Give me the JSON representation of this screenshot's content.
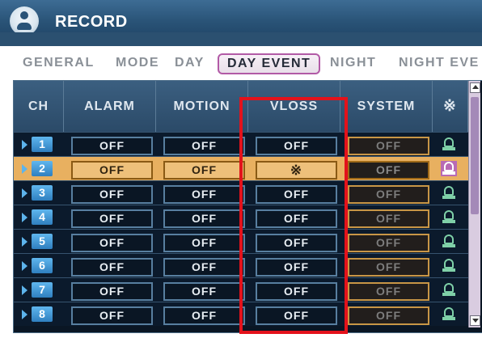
{
  "window": {
    "title": "RECORD",
    "logo_icon": "record-logo-icon"
  },
  "tabs": [
    {
      "label": "GENERAL",
      "active": false
    },
    {
      "label": "MODE",
      "active": false
    },
    {
      "label": "DAY",
      "active": false
    },
    {
      "label": "DAY EVENT",
      "active": true
    },
    {
      "label": "NIGHT",
      "active": false
    },
    {
      "label": "NIGHT EVE",
      "active": false
    }
  ],
  "table": {
    "columns": [
      "CH",
      "ALARM",
      "MOTION",
      "VLOSS",
      "SYSTEM",
      "※"
    ],
    "rows": [
      {
        "ch": "1",
        "alarm": "OFF",
        "motion": "OFF",
        "vloss": "OFF",
        "system": "OFF",
        "selected": false
      },
      {
        "ch": "2",
        "alarm": "OFF",
        "motion": "OFF",
        "vloss": "※",
        "system": "OFF",
        "selected": true
      },
      {
        "ch": "3",
        "alarm": "OFF",
        "motion": "OFF",
        "vloss": "OFF",
        "system": "OFF",
        "selected": false
      },
      {
        "ch": "4",
        "alarm": "OFF",
        "motion": "OFF",
        "vloss": "OFF",
        "system": "OFF",
        "selected": false
      },
      {
        "ch": "5",
        "alarm": "OFF",
        "motion": "OFF",
        "vloss": "OFF",
        "system": "OFF",
        "selected": false
      },
      {
        "ch": "6",
        "alarm": "OFF",
        "motion": "OFF",
        "vloss": "OFF",
        "system": "OFF",
        "selected": false
      },
      {
        "ch": "7",
        "alarm": "OFF",
        "motion": "OFF",
        "vloss": "OFF",
        "system": "OFF",
        "selected": false
      },
      {
        "ch": "8",
        "alarm": "OFF",
        "motion": "OFF",
        "vloss": "OFF",
        "system": "OFF",
        "selected": false
      }
    ]
  },
  "colors": {
    "header_bg": "#2b4a68",
    "selected_row": "#e8b060",
    "highlight_box": "#e3121b",
    "tab_active_border": "#b25aa6"
  }
}
